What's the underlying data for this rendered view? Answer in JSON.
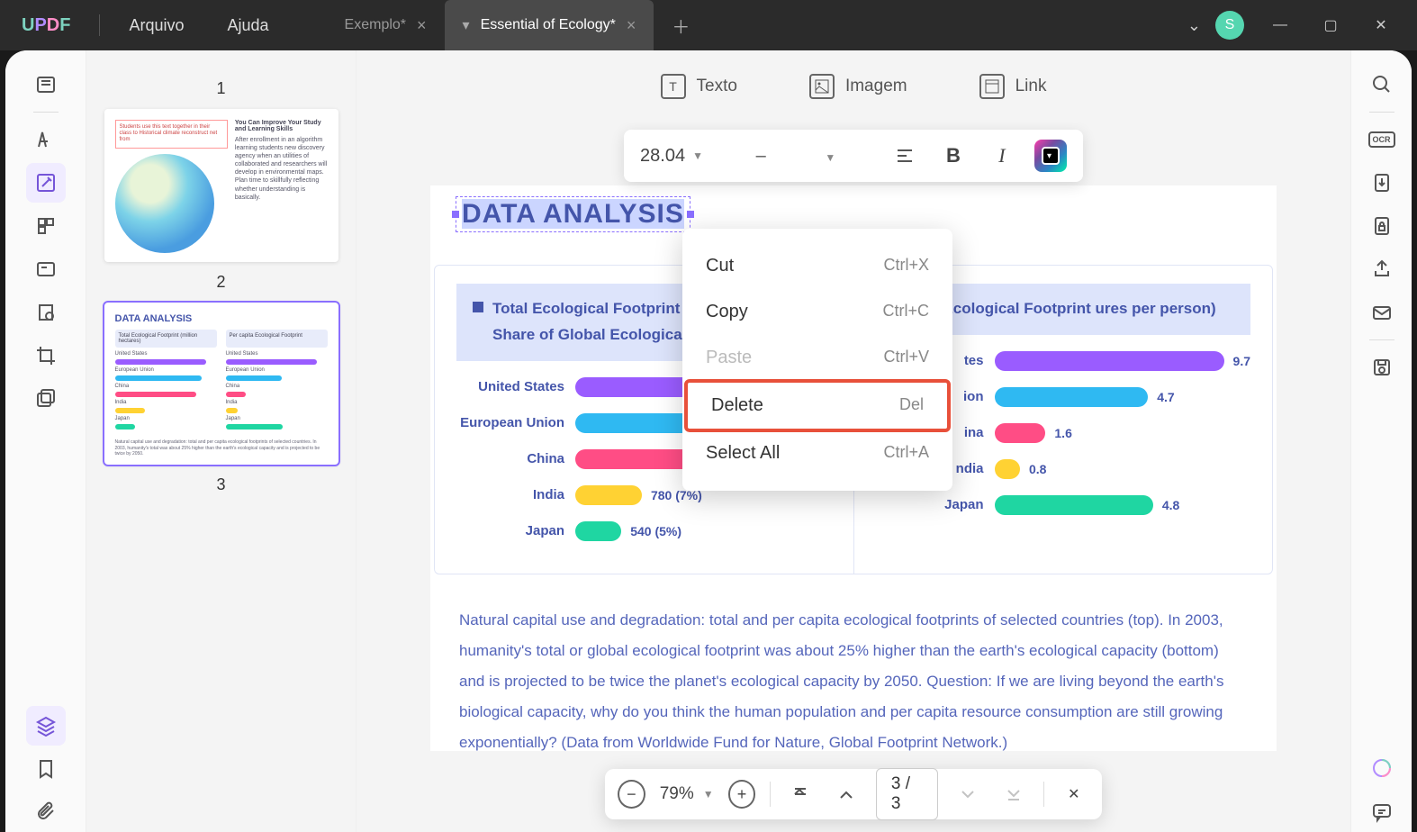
{
  "app": {
    "logo": "UPDF"
  },
  "menu": {
    "file": "Arquivo",
    "help": "Ajuda"
  },
  "tabs": {
    "inactive": "Exemplo*",
    "active": "Essential of Ecology*"
  },
  "avatar": "S",
  "edit_toolbar": {
    "text": "Texto",
    "image": "Imagem",
    "link": "Link"
  },
  "text_toolbar": {
    "font_size": "28.04",
    "font_family": "–",
    "bold": "B",
    "italic": "I"
  },
  "selected_text": "DATA ANALYSIS",
  "context_menu": {
    "cut": "Cut",
    "cut_k": "Ctrl+X",
    "copy": "Copy",
    "copy_k": "Ctrl+C",
    "paste": "Paste",
    "paste_k": "Ctrl+V",
    "delete": "Delete",
    "delete_k": "Del",
    "select_all": "Select All",
    "select_all_k": "Ctrl+A"
  },
  "chart_data": [
    {
      "type": "bar",
      "title": "Total Ecological Footprint (million and Share of Global Ecological Ca",
      "categories": [
        "United States",
        "European Union",
        "China",
        "India",
        "Japan"
      ],
      "series": [
        {
          "name": "total",
          "display": [
            "",
            "",
            "",
            "780 (7%)",
            "540 (5%)"
          ],
          "bar_pct": [
            100,
            96,
            90,
            26,
            18
          ]
        }
      ],
      "colors": [
        "#9a5cff",
        "#2fb9f2",
        "#ff4d85",
        "#ffd233",
        "#1fd6a2"
      ]
    },
    {
      "type": "bar",
      "title": "pita Ecological Footprint ures per person)",
      "categories": [
        "tes",
        "ion",
        "ina",
        "ndia",
        "Japan"
      ],
      "series": [
        {
          "name": "per_capita",
          "values": [
            9.7,
            4.7,
            1.6,
            0.8,
            4.8
          ],
          "bar_pct": [
            100,
            60,
            20,
            10,
            62
          ]
        }
      ],
      "colors": [
        "#9a5cff",
        "#2fb9f2",
        "#ff4d85",
        "#ffd233",
        "#1fd6a2"
      ]
    }
  ],
  "caption": "Natural capital use and degradation: total and per capita ecological footprints of selected countries (top). In 2003, humanity's total or global ecological footprint was about 25% higher than the earth's ecological capacity (bottom) and is projected to be twice the planet's ecological capacity by 2050. Question: If we are living beyond the earth's biological capacity, why do you think the human population and per capita resource consumption are still growing exponentially? (Data from Worldwide Fund for Nature, Global Footprint Network.)",
  "zoom": {
    "pct": "79%",
    "page": "3 / 3"
  },
  "thumbs": {
    "n1": "1",
    "n2": "2",
    "n3": "3",
    "t1_title": "You Can Improve Your Study and Learning Skills",
    "t2_title": "DATA ANALYSIS"
  }
}
